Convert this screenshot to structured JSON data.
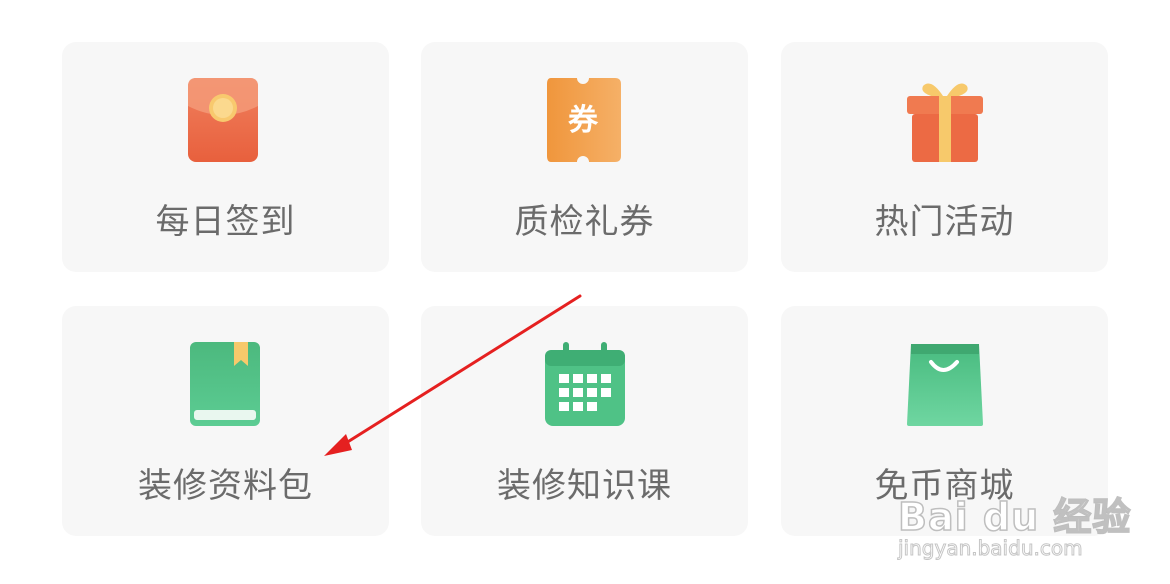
{
  "grid": {
    "items": [
      {
        "label": "每日签到",
        "icon": "red-envelope-icon"
      },
      {
        "label": "质检礼券",
        "icon": "coupon-icon",
        "icon_text": "券"
      },
      {
        "label": "热门活动",
        "icon": "gift-box-icon"
      },
      {
        "label": "装修资料包",
        "icon": "book-icon"
      },
      {
        "label": "装修知识课",
        "icon": "calendar-icon"
      },
      {
        "label": "免币商城",
        "icon": "shopping-bag-icon"
      }
    ]
  },
  "colors": {
    "tile_bg": "#f7f7f7",
    "label": "#6b6b6b",
    "orange_red": "#ee6a45",
    "coupon_orange": "#f3a04a",
    "gift_gold": "#f7c96b",
    "green": "#4fc286",
    "annotation_red": "#e52020"
  },
  "watermark": {
    "brand": "Bai du 经验",
    "url": "jingyan.baidu.com"
  }
}
